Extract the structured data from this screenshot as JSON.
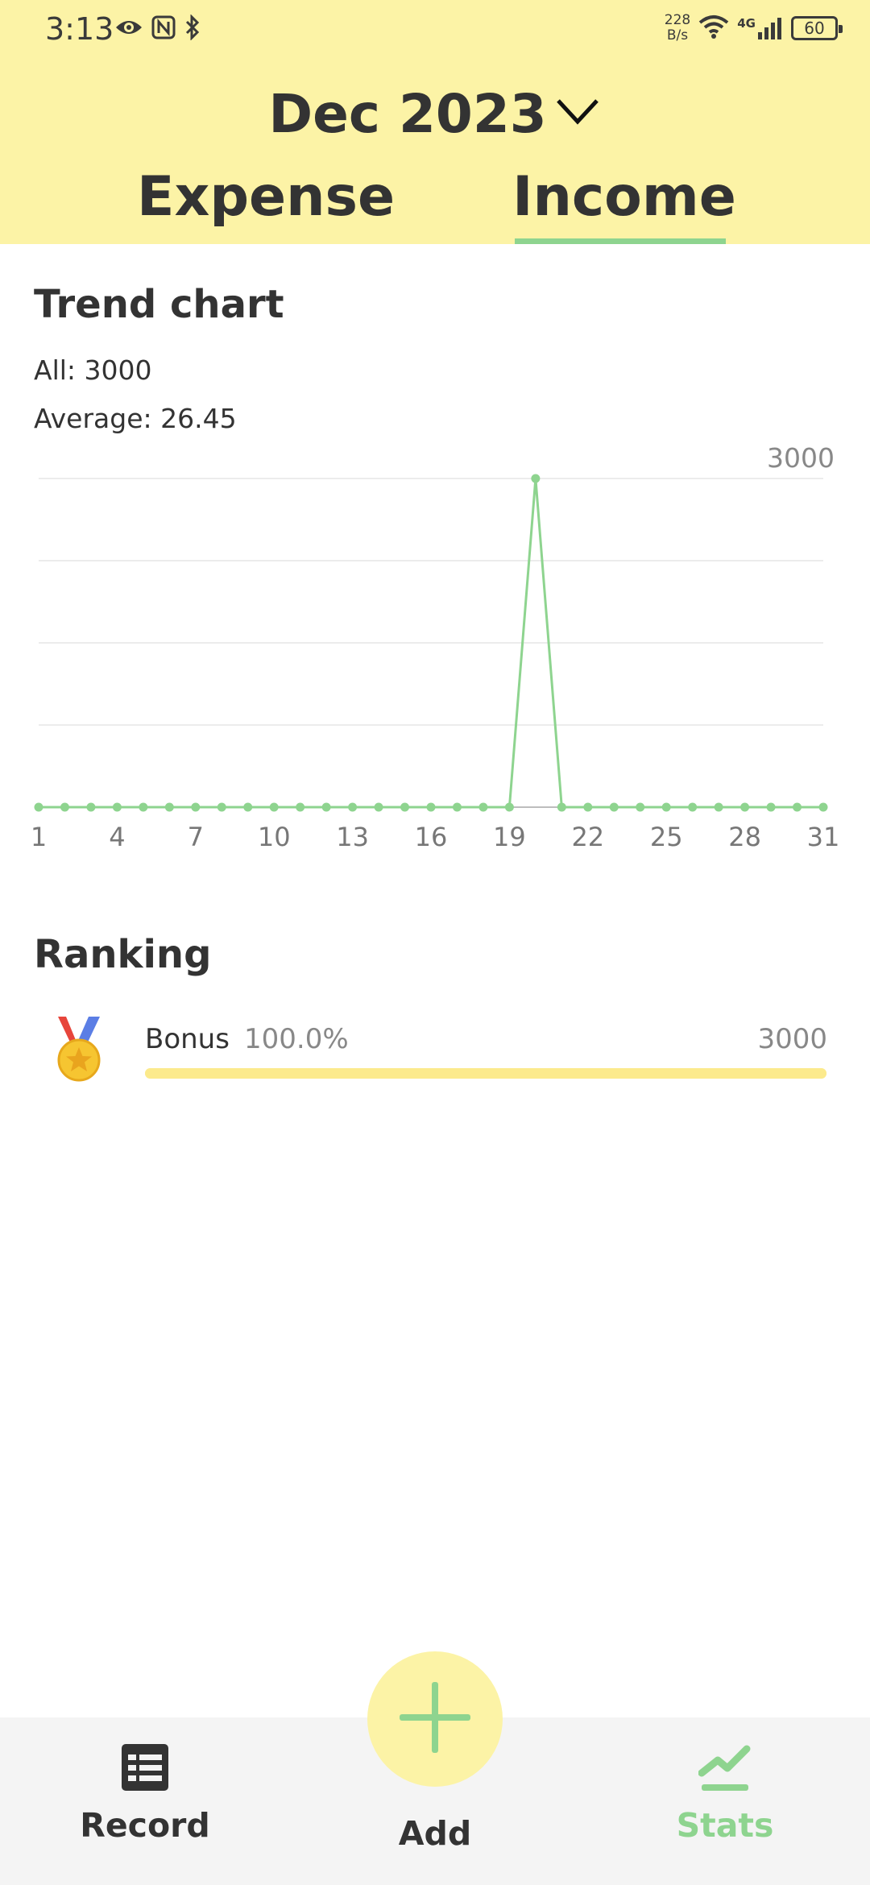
{
  "status_bar": {
    "time": "3:13",
    "net_speed_value": "228",
    "net_speed_unit": "B/s",
    "network_type": "4G",
    "battery": "60",
    "icons": [
      "eye-icon",
      "nfc-icon",
      "bluetooth-icon",
      "wifi-icon",
      "signal-icon",
      "battery-icon"
    ]
  },
  "header": {
    "month": "Dec 2023",
    "tabs": [
      {
        "label": "Expense",
        "active": false
      },
      {
        "label": "Income",
        "active": true
      }
    ]
  },
  "trend": {
    "title": "Trend chart",
    "all_label": "All: 3000",
    "average_label": "Average: 26.45"
  },
  "chart_data": {
    "type": "line",
    "x": [
      1,
      2,
      3,
      4,
      5,
      6,
      7,
      8,
      9,
      10,
      11,
      12,
      13,
      14,
      15,
      16,
      17,
      18,
      19,
      20,
      21,
      22,
      23,
      24,
      25,
      26,
      27,
      28,
      29,
      30,
      31
    ],
    "series": [
      {
        "values": [
          0,
          0,
          0,
          0,
          0,
          0,
          0,
          0,
          0,
          0,
          0,
          0,
          0,
          0,
          0,
          0,
          0,
          0,
          0,
          3000,
          0,
          0,
          0,
          0,
          0,
          0,
          0,
          0,
          0,
          0,
          0
        ]
      }
    ],
    "x_tick_labels": [
      "1",
      "4",
      "7",
      "10",
      "13",
      "16",
      "19",
      "22",
      "25",
      "28",
      "31"
    ],
    "max_label": "3000",
    "ylim": [
      0,
      3000
    ],
    "grid": true,
    "colors": {
      "line": "#8ed48f",
      "grid": "#ececec",
      "axis": "#bdbdbd"
    }
  },
  "ranking": {
    "title": "Ranking",
    "items": [
      {
        "name": "Bonus",
        "percent": "100.0%",
        "value": "3000",
        "fraction": 1.0,
        "icon": "gold-medal-icon"
      }
    ]
  },
  "nav": {
    "record_label": "Record",
    "add_label": "Add",
    "stats_label": "Stats",
    "active": "Stats"
  },
  "colors": {
    "header_bg": "#fcf3a6",
    "accent_green": "#8ed48f",
    "text_dark": "#333333",
    "text_muted": "#888888",
    "nav_bg": "#f4f4f4"
  }
}
